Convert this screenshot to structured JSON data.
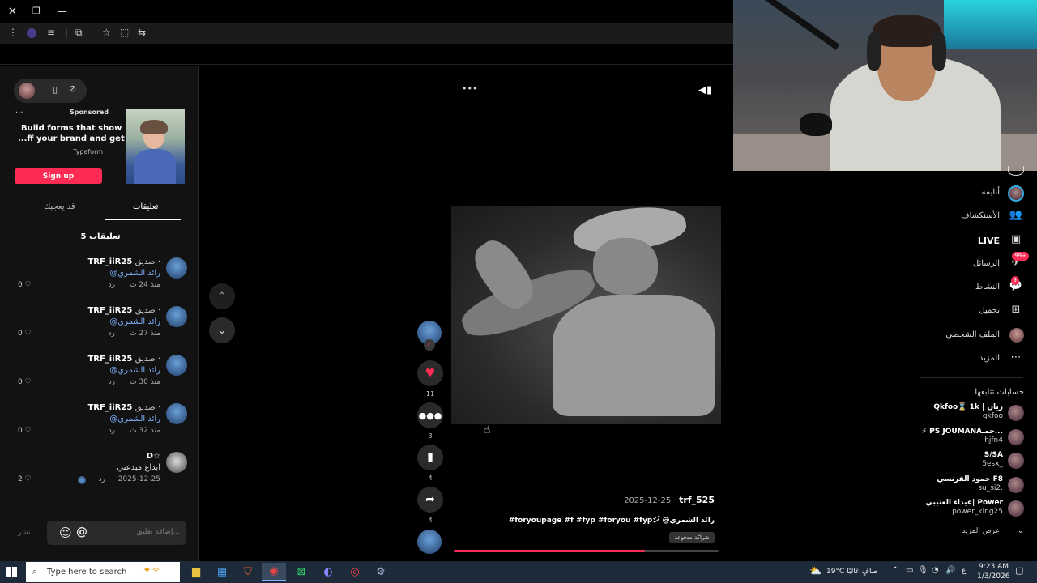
{
  "browser": {
    "window_controls": [
      "✕",
      "❐",
      "—"
    ]
  },
  "ad": {
    "menu": "...",
    "sponsored": "Sponsored",
    "headline_1": "Build forms that show",
    "headline_2": "...ff your brand and get",
    "brand": "Typeform",
    "cta": "Sign up"
  },
  "tabs": [
    {
      "label": "تعليقات",
      "active": true
    },
    {
      "label": "قد يعجبك",
      "active": false
    }
  ],
  "comments_title": "5 تعليقات",
  "comments": [
    {
      "name": "TRF_iiR25",
      "relation": "صديق ·",
      "text": "@رائد الشمري",
      "time": "منذ 24 ث",
      "reply": "رد",
      "likes": "0"
    },
    {
      "name": "TRF_iiR25",
      "relation": "صديق ·",
      "text": "@رائد الشمري",
      "time": "منذ 27 ث",
      "reply": "رد",
      "likes": "0"
    },
    {
      "name": "TRF_iiR25",
      "relation": "صديق ·",
      "text": "@رائد الشمري",
      "time": "منذ 30 ث",
      "reply": "رد",
      "likes": "0"
    },
    {
      "name": "TRF_iiR25",
      "relation": "صديق ·",
      "text": "@رائد الشمري",
      "time": "منذ 32 ث",
      "reply": "رد",
      "likes": "0"
    },
    {
      "name": "D☆",
      "relation": "",
      "text": "ابداع مبدعتي",
      "time": "2025-12-25",
      "reply": "رد",
      "likes": "2"
    }
  ],
  "reply_box": {
    "placeholder": "إضافة تعليق...",
    "post": "نشر",
    "emoji": "☺",
    "mention": "@"
  },
  "video": {
    "more": "•••",
    "author": "trf_525",
    "date": "2025-12-25 ·",
    "caption": "#foryoupage #f #fyp #foryou #fypシ゚ @رائد الشمري",
    "paid_tag": "شراكة مدفوعة",
    "progress": 0.72
  },
  "actions": [
    {
      "name": "like",
      "count": "11",
      "glyph": "♥",
      "color": "#fe2c55"
    },
    {
      "name": "comment",
      "count": "3",
      "glyph": "💬",
      "color": "#ddd"
    },
    {
      "name": "bookmark",
      "count": "4",
      "glyph": "🔖",
      "color": "#ddd"
    },
    {
      "name": "share",
      "count": "4",
      "glyph": "➦",
      "color": "#ddd"
    }
  ],
  "sidebar": {
    "items": [
      {
        "label": "أنايمه",
        "icon": "◉"
      },
      {
        "label": "الأستكشاف",
        "icon": "👥"
      },
      {
        "label": "LIVE",
        "icon": "▣"
      },
      {
        "label": "الرسائل",
        "icon": "✈",
        "badge": "99+"
      },
      {
        "label": "النشاط",
        "icon": "💬",
        "badge": "9"
      },
      {
        "label": "تحميل",
        "icon": "⊞"
      },
      {
        "label": "الملف الشخصي",
        "icon": "◍"
      },
      {
        "label": "المزيد",
        "icon": "⋯"
      }
    ],
    "following_title": "حسابات تتابعها",
    "following": [
      {
        "name": "Qkfoo⌛ 1k | ريان",
        "handle": "qkfoo"
      },
      {
        "name": "⚡ PS JOUMANAجمـ...",
        "handle": "hjfn4"
      },
      {
        "name": "S/SA",
        "handle": "5esx_"
      },
      {
        "name": "حمود القرنسي F8",
        "handle": "su_si2."
      },
      {
        "name": "غيداء العتيبي| Power",
        "handle": "power_king25"
      }
    ],
    "show_more": "عرض المزيد"
  },
  "taskbar": {
    "search_placeholder": "Type here to search",
    "weather": "19°C صافٍ غالبًا",
    "lang": "ع",
    "time": "9:23 AM",
    "date": "1/3/2026"
  }
}
